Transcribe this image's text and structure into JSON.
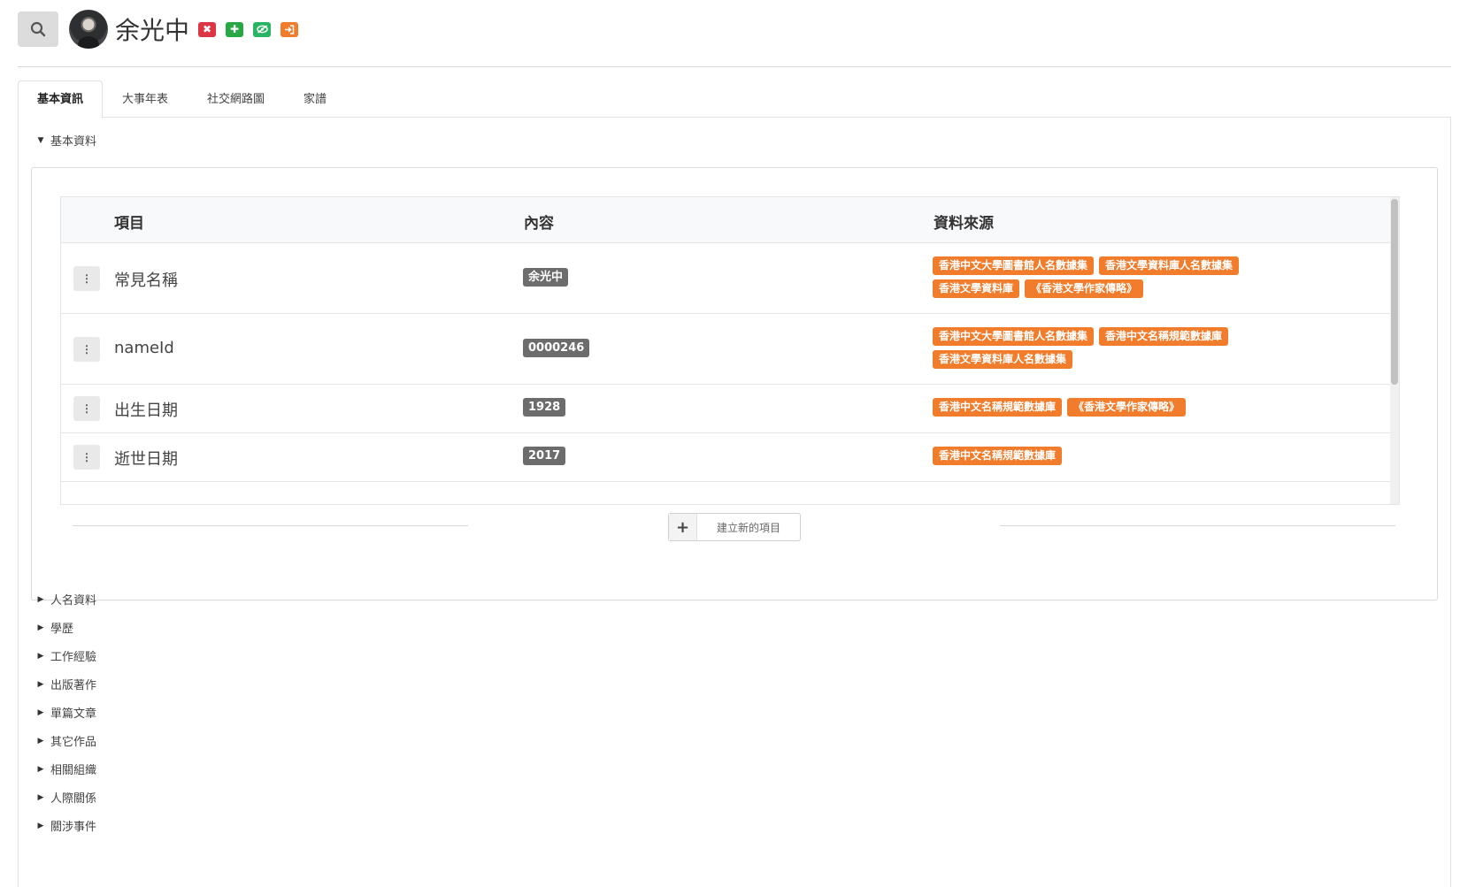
{
  "header": {
    "person_name": "余光中",
    "actions": [
      {
        "icon": "close-icon",
        "color": "#dc3545"
      },
      {
        "icon": "plus-icon",
        "color": "#28a745"
      },
      {
        "icon": "eye-slash-icon",
        "color": "#28b463"
      },
      {
        "icon": "sign-in-icon",
        "color": "#f07c2c"
      }
    ]
  },
  "tabs": [
    {
      "label": "基本資訊",
      "active": true
    },
    {
      "label": "大事年表",
      "active": false
    },
    {
      "label": "社交網路圖",
      "active": false
    },
    {
      "label": "家譜",
      "active": false
    }
  ],
  "basic_section": {
    "label": "基本資料",
    "expanded": true
  },
  "table": {
    "columns": [
      "項目",
      "內容",
      "資料來源"
    ],
    "rows": [
      {
        "label": "常見名稱",
        "value": "余光中",
        "sources": [
          "香港中文大學圖書館人名數據集",
          "香港文學資料庫人名數據集",
          "香港文學資料庫",
          "《香港文學作家傳略》"
        ]
      },
      {
        "label": "nameId",
        "value": "0000246",
        "sources": [
          "香港中文大學圖書館人名數據集",
          "香港中文名稱規範數據庫",
          "香港文學資料庫人名數據集"
        ]
      },
      {
        "label": "出生日期",
        "value": "1928",
        "sources": [
          "香港中文名稱規範數據庫",
          "《香港文學作家傳略》"
        ]
      },
      {
        "label": "逝世日期",
        "value": "2017",
        "sources": [
          "香港中文名稱規範數據庫"
        ]
      }
    ]
  },
  "add_button_label": "建立新的項目",
  "collapsed_sections": [
    "人名資料",
    "學歷",
    "工作經驗",
    "出版著作",
    "單篇文章",
    "其它作品",
    "相關組織",
    "人際關係",
    "關涉事件"
  ],
  "colors": {
    "source_tag": "#f07c2c",
    "value_badge": "#6c6c6c"
  }
}
